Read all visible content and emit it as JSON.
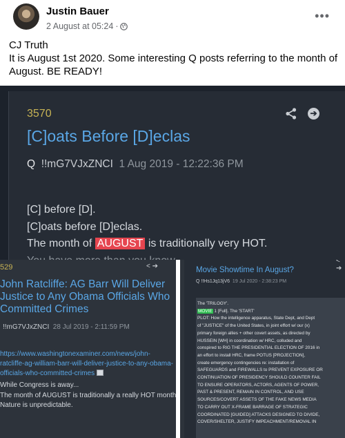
{
  "post": {
    "author": "Justin Bauer",
    "timestamp": "2 August at 05:24",
    "separator": "·",
    "privacy_icon": "globe-icon",
    "more_label": "•••",
    "text_line1": "CJ Truth",
    "text_line2": "It is August 1st 2020. Some interesting Q posts referring to the month of August. BE READY!"
  },
  "shot1": {
    "number": "3570",
    "title": "[C]oats Before [D]eclas",
    "q": "Q",
    "trip": "!!mG7VJxZNCI",
    "date": "1 Aug 2019 - 12:22:36 PM",
    "line1": "[C] before [D].",
    "line2": "[C]oats before [D]eclas.",
    "line3_pre": "The month of ",
    "line3_hl": "AUGUST",
    "line3_post": " is traditionally very HOT.",
    "line4": "You have more than you know.",
    "colors": {
      "background": "#262c35",
      "title": "#5aa7e6",
      "number": "#c8b455",
      "highlight": "#e6454f"
    }
  },
  "shot2": {
    "number": "529",
    "icons": "< ➔",
    "title": "John Ratcliffe: AG Barr Will Deliver Justice to Any Obama Officials Who Committed Crimes",
    "trip": "!!mG7VJxZNCI",
    "date": "28 Jul 2019 - 2:11:59 PM",
    "link": "https://www.washingtonexaminer.com/news/john-ratcliffe-ag-william-barr-will-deliver-justice-to-any-obama-officials-who-committed-crimes",
    "body1": "While Congress is away...",
    "body2": "The month of AUGUST is traditionally a really HOT month.",
    "body3": "Nature is unpredictable."
  },
  "shot3": {
    "icons": "< ➔",
    "title": "Movie Showtime In August?",
    "trip": "Q  !!Hs1Jq13jV6",
    "date": "19 Jul 2020 - 2:38:23 PM",
    "lines_pre": "The 'TRILOGY'.",
    "movie_tag": "MOVIE",
    "movie_rest": " 1 [Full]. The 'START'",
    "lines": [
      "PLOT: How the intelligence apparatus, State Dept, and Dept",
      "of \"JUSTICE\" of the United States, in joint effort w/ our (x)",
      "primary foreign allies + other covert assets, as directed by",
      "HUSSEIN [WH] in coordination w/ HRC, colluded and",
      "conspired to RIG THE PRESIDENTIAL ELECTION OF 2016 in",
      "an effort to install HRC, frame POTUS [PROJECTION],",
      "create emergency contingencies re: installation of",
      "SAFEGUARDS and FIREWALLS to PREVENT EXPOSURE OR",
      "CONTINUATION OF PRESIDENCY SHOULD COUNTER FAIL",
      "TO ENSURE OPERATORS, ACTORS, AGENTS OF POWER,",
      "PAST & PRESENT, REMAIN IN CONTROL, AND USE",
      "SOURCES/COVERT ASSETS OF THE FAKE NEWS MEDIA",
      "TO CARRY OUT X-FRAME BARRAGE OF STRATEGIC",
      "COORDINATED [GUIDED] ATTACKS DESIGNED TO DIVIDE,",
      "COVER/SHELTER, JUSTIFY IMPEACHMENT/REMOVAL IN"
    ]
  }
}
